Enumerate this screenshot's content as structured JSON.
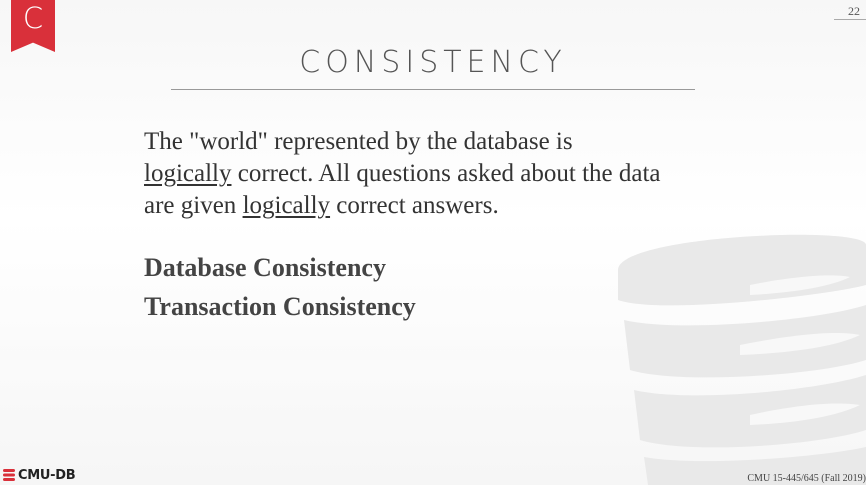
{
  "bookmark": {
    "letter": "C"
  },
  "page_number": "22",
  "title": "CONSISTENCY",
  "paragraph": {
    "l1": "The \"world\" represented by the database is",
    "l2_u": "logically",
    "l2_rest": " correct. All questions asked about the data",
    "l3_pre": "are given ",
    "l3_u": "logically",
    "l3_rest": " correct answers."
  },
  "items": [
    "Database Consistency",
    "Transaction Consistency"
  ],
  "logo": {
    "text": "CMU-DB",
    "icon": "database-logo-icon"
  },
  "footer": "CMU 15-445/645 (Fall 2019)",
  "colors": {
    "accent": "#d9303a",
    "text": "#333333",
    "watermark": "#e8e8e8"
  }
}
